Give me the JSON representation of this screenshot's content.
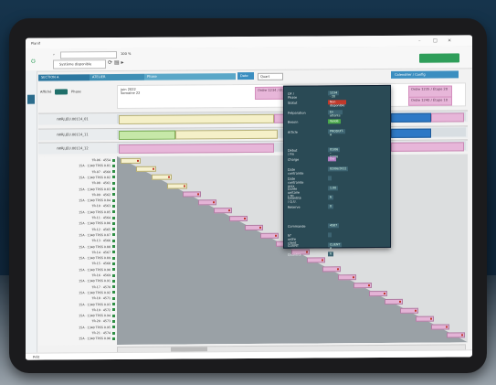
{
  "window": {
    "title": "Planif",
    "minimize": "–",
    "maximize": "□",
    "close": "×"
  },
  "toolbar": {
    "search_placeholder": "",
    "zoom": "100 %",
    "availability_label": "Système disponible",
    "icons": [
      "refresh-icon",
      "save-icon",
      "arrow-right-icon"
    ]
  },
  "header": {
    "segment_a": "SECTION A",
    "segment_b": "ATELIER",
    "segment_c": "Phase",
    "date_button": "Date",
    "period_select": "Quart",
    "right_button": "Calendrier / Config"
  },
  "filters": {
    "toggle_label": "Affiché",
    "toggle_text": "Phase",
    "ruler_line1": "juin 2022",
    "ruler_line2": "Semaine 22",
    "boxes": [
      "Ordre 1234 / Étape 10",
      "Ordre 1235 / Étape 20",
      "Ordre 1240 / Étape 10"
    ]
  },
  "popup": {
    "rows": [
      {
        "label": "OF / Phase",
        "value": "1234 · 20",
        "style": ""
      },
      {
        "label": "Statut",
        "value": "Non disponible",
        "style": "red"
      },
      {
        "label": "Préparation",
        "value": "En attente",
        "style": ""
      },
      {
        "label": "Besoin",
        "value": "Validé",
        "style": "green"
      },
      {
        "label": "Article",
        "value": "PRODUIT-A",
        "style": ""
      },
      {
        "label": "Début / Fin",
        "value": "01/06 – 03/06",
        "style": ""
      },
      {
        "label": "Charge",
        "value": "Oui",
        "style": "purple"
      },
      {
        "label": "Date contrainte",
        "value": "02/06/2022",
        "style": ""
      },
      {
        "label": "Date contrainte max",
        "value": "",
        "style": ""
      },
      {
        "label": "Durée unitaire / Tfr",
        "value": "1.00",
        "style": ""
      },
      {
        "label": "Quantité / Q.U.",
        "value": "6",
        "style": ""
      },
      {
        "label": "Réserve",
        "value": "0",
        "style": ""
      },
      {
        "label": "Commande",
        "value": "4587",
        "style": ""
      },
      {
        "label": "N° ordre client",
        "value": "",
        "style": ""
      },
      {
        "label": "CLIENT",
        "value": "CLIENT A",
        "style": ""
      },
      {
        "label": "Quantité",
        "value": "6",
        "style": ""
      }
    ]
  },
  "resources": [
    {
      "name": "rWRJ.JEU.00114_01"
    },
    {
      "name": "rWRJ.JEU.00114_11"
    },
    {
      "name": "rWRJ.JEU.00114_12"
    }
  ],
  "gantt_rows": [
    "TR-06 · 4554",
    "15A · 1340 TRSS 0.81",
    "TR-07 · 4560",
    "15A · 1340 TRSS 0.82",
    "TR-08 · 4561",
    "15A · 1340 TRSS 0.83",
    "TR-09 · 4562",
    "15A · 1340 TRSS 0.84",
    "TR-10 · 4563",
    "15A · 1340 TRSS 0.85",
    "TR-11 · 4564",
    "15A · 1340 TRSS 0.86",
    "TR-12 · 4565",
    "15A · 1340 TRSS 0.87",
    "TR-13 · 4566",
    "15A · 1340 TRSS 0.88",
    "TR-14 · 4567",
    "15A · 1340 TRSS 0.89",
    "TR-15 · 4568",
    "15A · 1340 TRSS 0.90",
    "TR-16 · 4569",
    "15A · 1340 TRSS 0.91",
    "TR-17 · 4570",
    "15A · 1340 TRSS 0.92",
    "TR-18 · 4571",
    "15A · 1340 TRSS 0.93",
    "TR-19 · 4572",
    "15A · 1340 TRSS 0.94",
    "TR-20 · 4573",
    "15A · 1340 TRSS 0.95",
    "TR-21 · 4574",
    "15A · 1340 TRSS 0.96"
  ],
  "footer": {
    "status": "Prêt"
  }
}
